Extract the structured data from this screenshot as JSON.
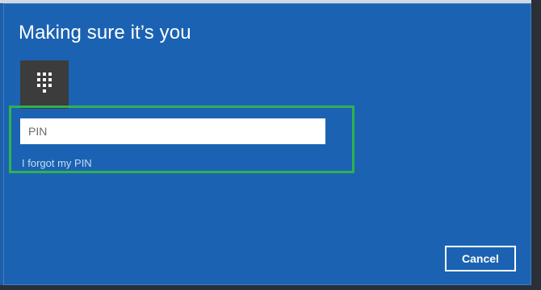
{
  "dialog": {
    "title": "Making sure it’s you",
    "icon": "pin-keypad-icon",
    "pin_field": {
      "placeholder": "PIN",
      "value": ""
    },
    "forgot_link": "I forgot my PIN",
    "cancel_label": "Cancel"
  },
  "colors": {
    "dialog_bg": "#1b63b2",
    "tile_bg": "#3c3c3c",
    "highlight": "#2fb24f",
    "link": "#c7dcf3"
  }
}
